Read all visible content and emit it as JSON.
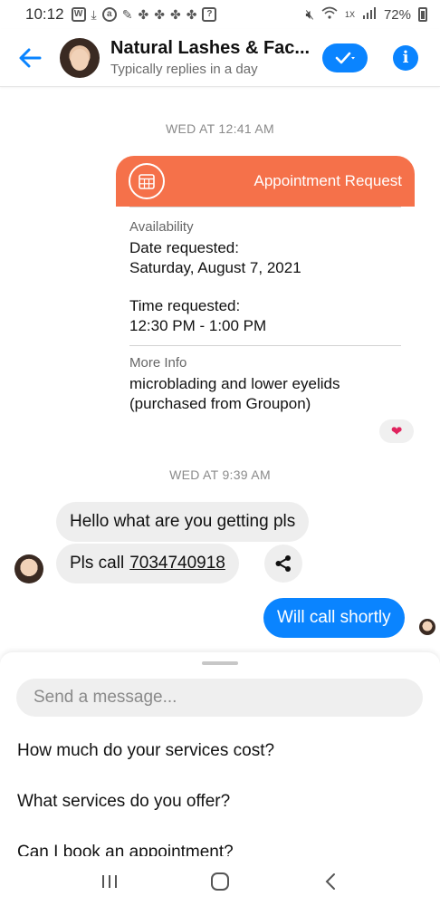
{
  "status_bar": {
    "time": "10:12",
    "battery": "72%",
    "signal_label": "1X"
  },
  "header": {
    "title": "Natural Lashes & Fac...",
    "subtitle": "Typically replies in a day"
  },
  "conversation": {
    "timestamp_1": "WED AT 12:41 AM",
    "appointment": {
      "title": "Appointment Request",
      "availability_label": "Availability",
      "date_label": "Date requested:",
      "date_value": "Saturday, August 7, 2021",
      "time_label": "Time requested:",
      "time_value": "12:30 PM - 1:00 PM",
      "more_info_label": "More Info",
      "more_info_line1": "microblading and lower eyelids",
      "more_info_line2": "(purchased from Groupon)"
    },
    "reaction": "❤",
    "timestamp_2": "WED AT 9:39 AM",
    "incoming_1": "Hello what are you getting pls",
    "incoming_2_prefix": "Pls call",
    "incoming_2_phone": "7034740918",
    "outgoing_1": "Will call shortly"
  },
  "composer": {
    "placeholder": "Send a message...",
    "quick_replies": [
      "How much do your services cost?",
      "What services do you offer?",
      "Can I book an appointment?"
    ]
  },
  "colors": {
    "accent": "#0a84ff",
    "appointment_header": "#f5714a"
  }
}
